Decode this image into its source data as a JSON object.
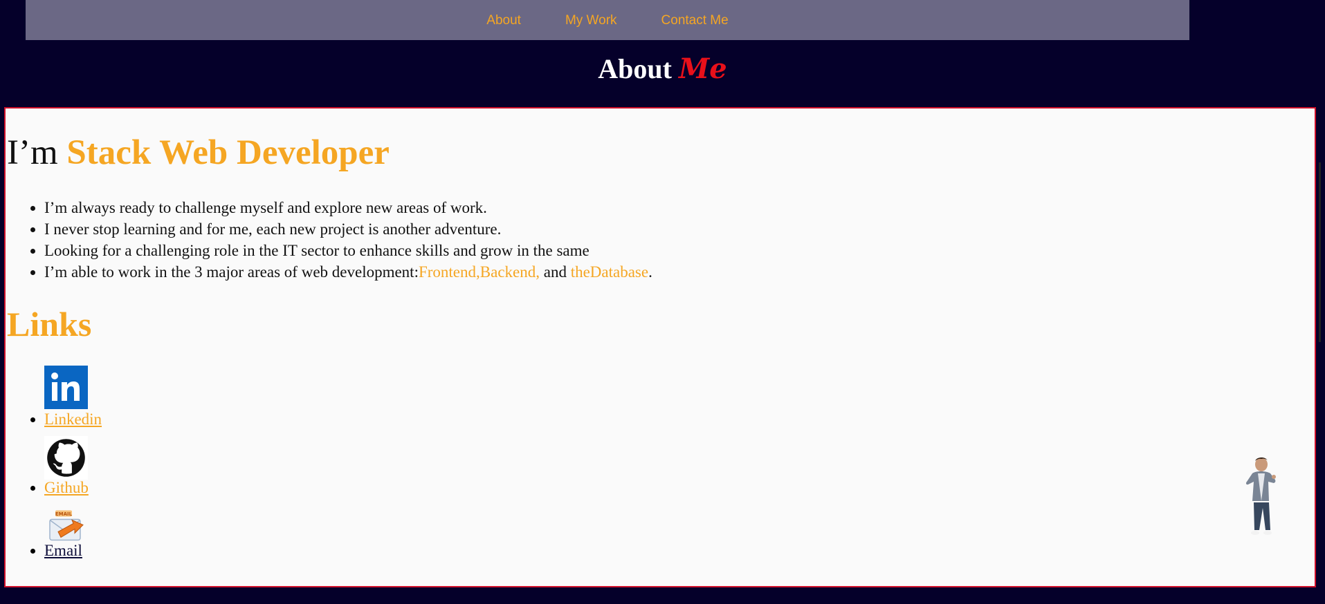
{
  "nav": {
    "items": [
      {
        "label": "About"
      },
      {
        "label": "My Work"
      },
      {
        "label": "Contact Me"
      }
    ]
  },
  "about": {
    "heading_main": "About",
    "heading_accent": "Me"
  },
  "intro": {
    "prefix": "I’m",
    "role": "Stack Web Developer"
  },
  "bullets": {
    "b1": "I’m always ready to challenge myself and explore new areas of work.",
    "b2": "I never stop learning and for me, each new project is another adventure.",
    "b3": "Looking for a challenging role in the IT sector to enhance skills and grow in the same",
    "b4_prefix": "I’m able to work in the 3 major areas of web development:",
    "b4_hl1": "Frontend,Backend,",
    "b4_mid": " and ",
    "b4_hl2": "theDatabase",
    "b4_suffix": "."
  },
  "links": {
    "heading": "Links",
    "linkedin": "Linkedin",
    "github": "Github",
    "email": "Email"
  },
  "colors": {
    "background": "#05002a",
    "nav_bg": "#6b6885",
    "accent_orange": "#f5a623",
    "accent_red": "#e8101a",
    "content_bg": "#fafafa"
  },
  "icons": [
    "linkedin-icon",
    "github-icon",
    "email-icon",
    "avatar-figure"
  ]
}
